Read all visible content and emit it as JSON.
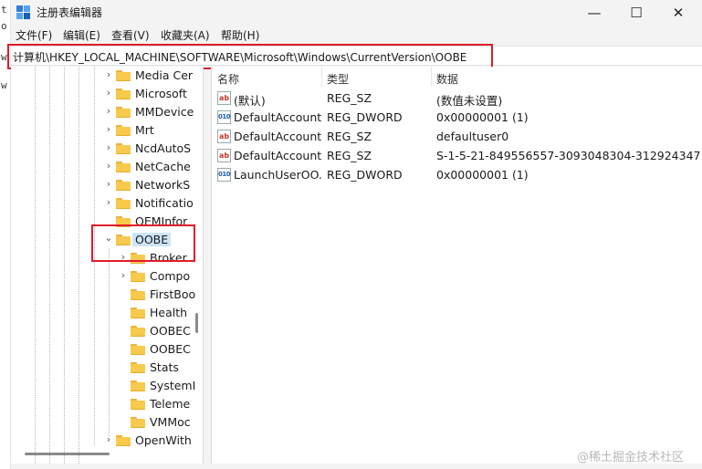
{
  "background_window": {
    "chars": [
      "t",
      "o",
      "w",
      "w"
    ]
  },
  "window": {
    "title": "注册表编辑器",
    "controls": {
      "minimize": "—",
      "maximize": "☐",
      "close": "✕"
    }
  },
  "menu": [
    "文件(F)",
    "编辑(E)",
    "查看(V)",
    "收藏夹(A)",
    "帮助(H)"
  ],
  "address": "计算机\\HKEY_LOCAL_MACHINE\\SOFTWARE\\Microsoft\\Windows\\CurrentVersion\\OOBE",
  "tree": {
    "items": [
      {
        "label": "Media Cer",
        "expandable": true
      },
      {
        "label": "Microsoft",
        "expandable": true
      },
      {
        "label": "MMDevice",
        "expandable": true
      },
      {
        "label": "Mrt",
        "expandable": true
      },
      {
        "label": "NcdAutoS",
        "expandable": true
      },
      {
        "label": "NetCache",
        "expandable": true
      },
      {
        "label": "NetworkS",
        "expandable": true
      },
      {
        "label": "Notificatio",
        "expandable": true
      },
      {
        "label": "OEMInfor",
        "expandable": false
      },
      {
        "label": "OOBE",
        "expandable": true,
        "expanded": true,
        "selected": true
      },
      {
        "label": "Broker",
        "expandable": true
      },
      {
        "label": "Compo",
        "expandable": true
      },
      {
        "label": "FirstBoo",
        "expandable": false
      },
      {
        "label": "Health",
        "expandable": false
      },
      {
        "label": "OOBEC",
        "expandable": false
      },
      {
        "label": "OOBEC",
        "expandable": false
      },
      {
        "label": "Stats",
        "expandable": false
      },
      {
        "label": "SystemI",
        "expandable": false
      },
      {
        "label": "Teleme",
        "expandable": false
      },
      {
        "label": "VMMoc",
        "expandable": false
      },
      {
        "label": "OpenWith",
        "expandable": true
      }
    ]
  },
  "values": {
    "headers": {
      "name": "名称",
      "type": "类型",
      "data": "数据"
    },
    "rows": [
      {
        "icon": "string-value-icon",
        "icon_text": "ab",
        "name": "(默认)",
        "type": "REG_SZ",
        "data": "(数值未设置)"
      },
      {
        "icon": "dword-value-icon",
        "icon_text": "010",
        "name": "DefaultAccount...",
        "type": "REG_DWORD",
        "data": "0x00000001 (1)"
      },
      {
        "icon": "string-value-icon",
        "icon_text": "ab",
        "name": "DefaultAccount...",
        "type": "REG_SZ",
        "data": "defaultuser0"
      },
      {
        "icon": "string-value-icon",
        "icon_text": "ab",
        "name": "DefaultAccount...",
        "type": "REG_SZ",
        "data": "S-1-5-21-849556557-3093048304-312924347..."
      },
      {
        "icon": "dword-value-icon",
        "icon_text": "010",
        "name": "LaunchUserOO...",
        "type": "REG_DWORD",
        "data": "0x00000001 (1)"
      }
    ]
  },
  "watermark": "@稀土掘金技术社区",
  "colors": {
    "highlight_box": "#e01b2a",
    "selection": "#cce4f7",
    "folder": "#f7c94c"
  }
}
